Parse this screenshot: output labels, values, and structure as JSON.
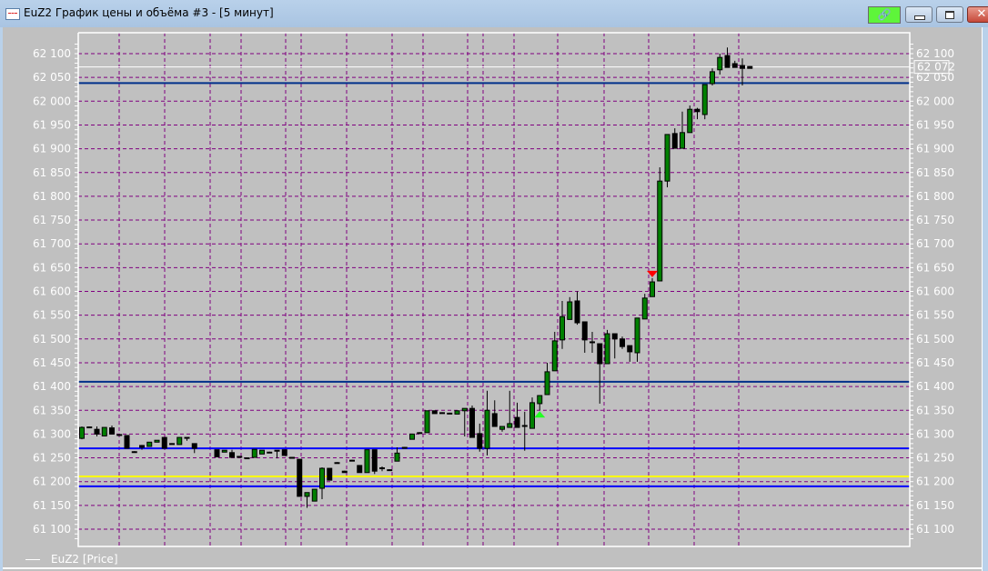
{
  "window": {
    "title": "EuZ2 График цены и объёма #3 - [5 минут]",
    "link_icon": "🔗",
    "close_label": "✕"
  },
  "legend": {
    "label": "EuZ2 [Price]"
  },
  "colors": {
    "background": "#c0c0c0",
    "grid": "#800080",
    "bull": "#008000",
    "bear": "#000000",
    "level_dark": "#00308a",
    "level_blue": "#0000ff",
    "level_yellow": "#ffff00",
    "current": "#ffffff",
    "buy_marker": "#22ff22",
    "sell_marker": "#ff0000"
  },
  "chart_data": {
    "type": "candlestick",
    "y_ticks": [
      62100,
      62050,
      62000,
      61950,
      61900,
      61850,
      61800,
      61750,
      61700,
      61650,
      61600,
      61550,
      61500,
      61450,
      61400,
      61350,
      61300,
      61250,
      61200,
      61150,
      61100
    ],
    "tick_labels": [
      "62 100",
      "62 050",
      "62 000",
      "61 950",
      "61 900",
      "61 850",
      "61 800",
      "61 750",
      "61 700",
      "61 650",
      "61 600",
      "61 550",
      "61 500",
      "61 450",
      "61 400",
      "61 350",
      "61 300",
      "61 250",
      "61 200",
      "61 150",
      "61 100"
    ],
    "current_price": 62072,
    "current_price_label": "62 072",
    "levels": [
      {
        "price": 62038,
        "color": "level_dark"
      },
      {
        "price": 61410,
        "color": "level_dark"
      },
      {
        "price": 61270,
        "color": "level_blue"
      },
      {
        "price": 61211,
        "color": "level_yellow"
      },
      {
        "price": 61190,
        "color": "level_blue"
      }
    ],
    "markers": [
      {
        "index": 61,
        "type": "buy"
      },
      {
        "index": 76,
        "type": "sell"
      }
    ],
    "candles_ohlc": [
      [
        61291,
        61316,
        61289,
        61314
      ],
      [
        61315,
        61316,
        61314,
        61315
      ],
      [
        61310,
        61316,
        61295,
        61300
      ],
      [
        61296,
        61314,
        61295,
        61314
      ],
      [
        61313,
        61318,
        61299,
        61300
      ],
      [
        61299,
        61300,
        61296,
        61297
      ],
      [
        61297,
        61297,
        61270,
        61270
      ],
      [
        61263,
        61264,
        61262,
        61263
      ],
      [
        61276,
        61277,
        61267,
        61272
      ],
      [
        61274,
        61283,
        61274,
        61283
      ],
      [
        61283,
        61287,
        61283,
        61287
      ],
      [
        61293,
        61293,
        61270,
        61270
      ],
      [
        61280,
        61281,
        61279,
        61280
      ],
      [
        61278,
        61293,
        61278,
        61293
      ],
      [
        61293,
        61293,
        61286,
        61292
      ],
      [
        61280,
        61280,
        61260,
        61270
      ],
      null,
      null,
      [
        61267,
        61267,
        61252,
        61252
      ],
      [
        61262,
        61266,
        61262,
        61266
      ],
      [
        61261,
        61267,
        61251,
        61251
      ],
      [
        61253,
        61254,
        61252,
        61253
      ],
      [
        61250,
        61251,
        61249,
        61250
      ],
      [
        61251,
        61268,
        61251,
        61268
      ],
      [
        61258,
        61266,
        61258,
        61266
      ],
      [
        61262,
        61263,
        61261,
        61262
      ],
      [
        61266,
        61266,
        61249,
        61264
      ],
      [
        61267,
        61267,
        61255,
        61255
      ],
      [
        61251,
        61252,
        61250,
        61251
      ],
      [
        61247,
        61247,
        61169,
        61169
      ],
      [
        61169,
        61177,
        61145,
        61177
      ],
      [
        61159,
        61184,
        61159,
        61184
      ],
      [
        61186,
        61230,
        61163,
        61228
      ],
      [
        61228,
        61228,
        61203,
        61203
      ],
      [
        61240,
        61241,
        61239,
        61240
      ],
      [
        61222,
        61223,
        61219,
        61219
      ],
      [
        61245,
        61246,
        61244,
        61245
      ],
      [
        61234,
        61234,
        61219,
        61219
      ],
      [
        61219,
        61267,
        61219,
        61267
      ],
      [
        61267,
        61267,
        61216,
        61222
      ],
      [
        61229,
        61232,
        61222,
        61229
      ],
      [
        61225,
        61226,
        61224,
        61225
      ],
      [
        61243,
        61272,
        61243,
        61260
      ],
      [
        61272,
        61273,
        61271,
        61272
      ],
      [
        61289,
        61300,
        61289,
        61300
      ],
      [
        61303,
        61304,
        61302,
        61303
      ],
      [
        61303,
        61349,
        61303,
        61349
      ],
      [
        61349,
        61349,
        61343,
        61343
      ],
      [
        61345,
        61346,
        61344,
        61345
      ],
      [
        61344,
        61345,
        61343,
        61344
      ],
      [
        61342,
        61349,
        61342,
        61349
      ],
      [
        61349,
        61354,
        61295,
        61354
      ],
      [
        61354,
        61360,
        61293,
        61293
      ],
      [
        61301,
        61322,
        61263,
        61270
      ],
      [
        61270,
        61391,
        61255,
        61350
      ],
      [
        61343,
        61371,
        61316,
        61316
      ],
      [
        61310,
        61316,
        61305,
        61316
      ],
      [
        61314,
        61391,
        61314,
        61322
      ],
      [
        61335,
        61366,
        61314,
        61314
      ],
      [
        61318,
        61347,
        61265,
        61318
      ],
      [
        61312,
        61377,
        61312,
        61366
      ],
      [
        61364,
        61381,
        61350,
        61381
      ],
      [
        61383,
        61450,
        61383,
        61431
      ],
      [
        61433,
        61515,
        61433,
        61496
      ],
      [
        61498,
        61580,
        61479,
        61547
      ],
      [
        61541,
        61588,
        61541,
        61578
      ],
      [
        61580,
        61600,
        61530,
        61534
      ],
      [
        61536,
        61536,
        61471,
        61498
      ],
      [
        61494,
        61515,
        61471,
        61494
      ],
      [
        61490,
        61490,
        61364,
        61448
      ],
      [
        61448,
        61519,
        61448,
        61511
      ],
      [
        61511,
        61511,
        61459,
        61500
      ],
      [
        61500,
        61505,
        61479,
        61484
      ],
      [
        61486,
        61486,
        61452,
        61473
      ],
      [
        61471,
        61544,
        61452,
        61544
      ],
      [
        61542,
        61595,
        61542,
        61586
      ],
      [
        61589,
        61628,
        61589,
        61620
      ],
      [
        61622,
        61861,
        61622,
        61832
      ],
      [
        61832,
        61930,
        61819,
        61930
      ],
      [
        61932,
        61943,
        61901,
        61901
      ],
      [
        61901,
        61978,
        61901,
        61934
      ],
      [
        61934,
        61991,
        61934,
        61983
      ],
      [
        61983,
        61986,
        61962,
        61978
      ],
      [
        61972,
        62035,
        61962,
        62035
      ],
      [
        62037,
        62069,
        62033,
        62062
      ],
      [
        62066,
        62100,
        62056,
        62092
      ],
      [
        62096,
        62113,
        62071,
        62071
      ],
      [
        62079,
        62085,
        62071,
        62071
      ],
      [
        62075,
        62090,
        62033,
        62069
      ],
      [
        62073,
        62074,
        62069,
        62069
      ]
    ]
  }
}
